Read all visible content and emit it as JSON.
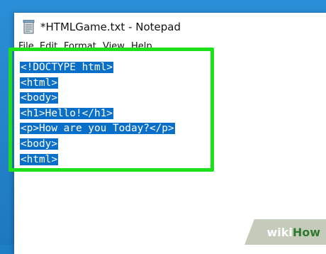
{
  "window": {
    "title": "*HTMLGame.txt - Notepad"
  },
  "menu": [
    {
      "label": "File"
    },
    {
      "label": "Edit"
    },
    {
      "label": "Format"
    },
    {
      "label": "View"
    },
    {
      "label": "Help"
    }
  ],
  "editor": {
    "lines": [
      "<!DOCTYPE html>",
      "<html>",
      "<body>",
      "<h1>Hello!</h1>",
      "<p>How are you Today?</p>",
      "<body>",
      "<html>"
    ],
    "selection_color": "#0a6fc9"
  },
  "highlight": {
    "color": "#1ee01a"
  },
  "watermark": {
    "wiki": "wiki",
    "how": "How"
  },
  "icons": {
    "app": "notepad-icon"
  }
}
